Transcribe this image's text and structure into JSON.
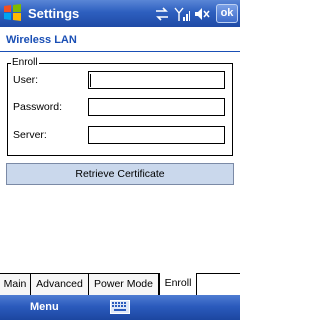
{
  "titlebar": {
    "title": "Settings",
    "ok_label": "ok",
    "icons": [
      "windows-logo",
      "connectivity-icon",
      "signal-strength-icon",
      "volume-icon"
    ]
  },
  "page": {
    "title": "Wireless LAN"
  },
  "enroll": {
    "group_label": "Enroll",
    "fields": [
      {
        "label": "User:",
        "value": ""
      },
      {
        "label": "Password:",
        "value": ""
      },
      {
        "label": "Server:",
        "value": ""
      }
    ],
    "button_label": "Retrieve Certificate"
  },
  "tabs": [
    {
      "label": "Main",
      "active": false
    },
    {
      "label": "Advanced",
      "active": false
    },
    {
      "label": "Power Mode",
      "active": false
    },
    {
      "label": "Enroll",
      "active": true
    }
  ],
  "softkeys": {
    "left_label": "Menu",
    "center_icon": "keyboard-icon"
  },
  "colors": {
    "titlebar": "#2d5fbf",
    "header_text": "#1a4fb5",
    "button_bg": "#cad8ec"
  }
}
